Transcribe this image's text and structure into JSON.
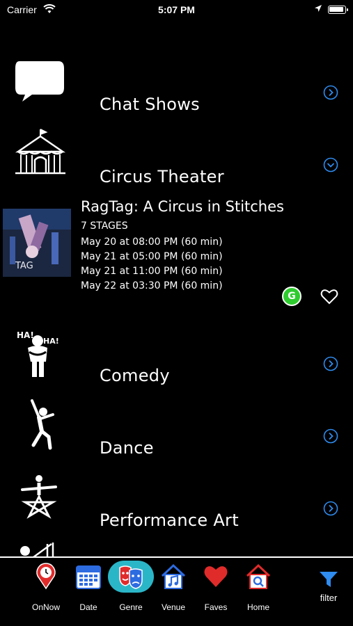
{
  "status": {
    "carrier": "Carrier",
    "time": "5:07 PM"
  },
  "genres_top": [
    {
      "label": "Chat Shows",
      "icon": "speech-bubble-icon"
    },
    {
      "label": "Circus Theater",
      "icon": "circus-tent-icon"
    }
  ],
  "event": {
    "title": "RagTag: A Circus in Stitches",
    "venue": "7 STAGES",
    "times": [
      "May 20 at 08:00 PM (60 min)",
      "May 21 at 05:00 PM (60 min)",
      "May 21 at 11:00 PM (60 min)",
      "May 22 at 03:30 PM (60 min)"
    ],
    "rating": "G"
  },
  "genres_bottom": [
    {
      "label": "Comedy",
      "icon": "comedy-laughing-icon"
    },
    {
      "label": "Dance",
      "icon": "dancer-icon"
    },
    {
      "label": "Performance Art",
      "icon": "performance-art-icon"
    }
  ],
  "tabs": [
    {
      "label": "OnNow",
      "icon": "map-pin-clock-icon"
    },
    {
      "label": "Date",
      "icon": "calendar-icon"
    },
    {
      "label": "Genre",
      "icon": "theater-masks-icon"
    },
    {
      "label": "Venue",
      "icon": "music-house-icon"
    },
    {
      "label": "Faves",
      "icon": "heart-icon"
    },
    {
      "label": "Home",
      "icon": "home-search-icon"
    }
  ],
  "filter": {
    "label": "filter",
    "icon": "funnel-icon"
  },
  "colors": {
    "accent": "#2f8cf0",
    "active_tab": "#2bb6c8",
    "rating": "#2ecc2e"
  }
}
